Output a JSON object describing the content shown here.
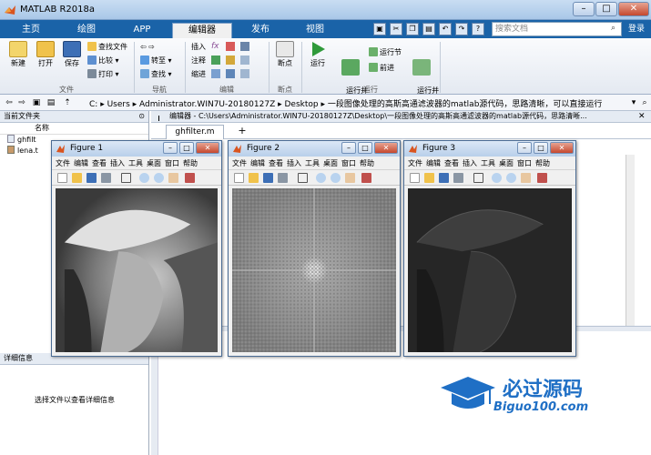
{
  "window": {
    "title": "MATLAB R2018a",
    "min": "–",
    "max": "□",
    "close": "✕"
  },
  "tabs": [
    {
      "label": "主页"
    },
    {
      "label": "绘图"
    },
    {
      "label": "APP"
    },
    {
      "label": "编辑器"
    },
    {
      "label": "发布"
    },
    {
      "label": "视图"
    }
  ],
  "search": {
    "placeholder": "搜索文档"
  },
  "login": "登录",
  "ribbon": {
    "file": {
      "new": "新建",
      "open": "打开",
      "save": "保存",
      "find_files": "查找文件",
      "compare": "比较",
      "print": "打印",
      "group": "文件"
    },
    "nav": {
      "goto": "转至",
      "find": "查找",
      "group": "导航"
    },
    "edit": {
      "insert": "插入",
      "comment": "注释",
      "indent": "缩进",
      "fx": "fx",
      "group": "编辑"
    },
    "breakpoint": {
      "label": "断点",
      "group": "断点"
    },
    "run": {
      "run": "运行",
      "run_advance": "运行并\n前进",
      "run_section": "运行节",
      "advance": "前进",
      "run_time": "运行并\n计时",
      "group": "运行"
    }
  },
  "address": {
    "path": [
      "C:",
      "Users",
      "Administrator.WIN7U-20180127Z",
      "Desktop",
      "一段图像处理的高斯高通滤波器的matlab源代码，思路清晰，可以直接运行"
    ]
  },
  "current_folder": {
    "header": "当前文件夹",
    "col_name": "名称",
    "files": [
      {
        "name": "ghfilt"
      },
      {
        "name": "lena.t"
      }
    ],
    "details_header": "详细信息",
    "details_msg": "选择文件以查看详细信息"
  },
  "editor": {
    "title": "编辑器 - C:\\Users\\Administrator.WIN7U-20180127Z\\Desktop\\一段图像处理的高斯高通滤波器的matlab源代码，思路清晰...",
    "tab": "ghfilter.m",
    "add_tab": "+"
  },
  "figures": [
    {
      "title": "Figure 1",
      "menu": [
        "文件",
        "编辑",
        "查看",
        "插入",
        "工具",
        "桌面",
        "窗口",
        "帮助"
      ]
    },
    {
      "title": "Figure 2",
      "menu": [
        "文件",
        "编辑",
        "查看",
        "插入",
        "工具",
        "桌面",
        "窗口",
        "帮助"
      ]
    },
    {
      "title": "Figure 3",
      "menu": [
        "文件",
        "编辑",
        "查看",
        "插入",
        "工具",
        "桌面",
        "窗口",
        "帮助"
      ]
    }
  ],
  "watermark": {
    "cn": "必过源码",
    "en": "Biguo100.com"
  }
}
